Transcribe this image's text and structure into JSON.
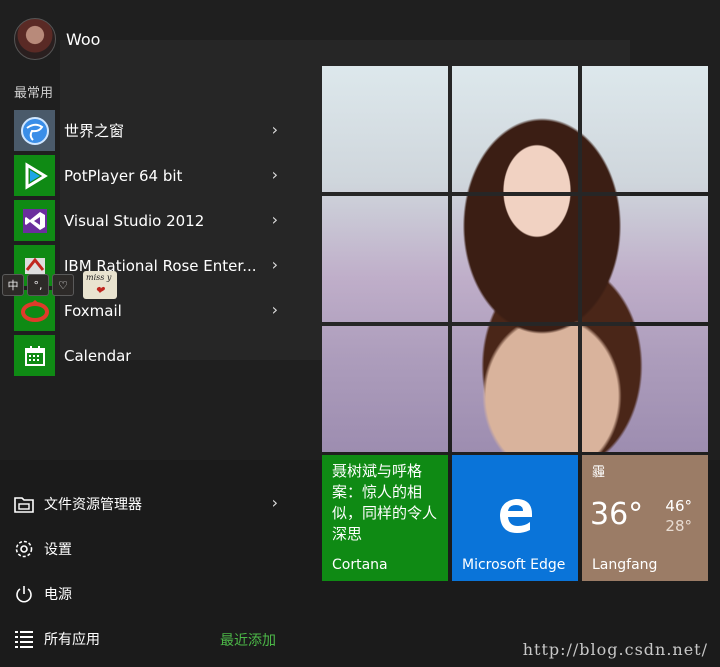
{
  "user": {
    "name": "Woo"
  },
  "left": {
    "section_label": "最常用",
    "apps": [
      {
        "label": "世界之窗",
        "icon": "globe-icon",
        "color": "#4a5a6a",
        "has_arrow": true
      },
      {
        "label": "PotPlayer 64 bit",
        "icon": "play-icon",
        "color": "#0f8a14",
        "has_arrow": true
      },
      {
        "label": "Visual Studio 2012",
        "icon": "visual-studio-icon",
        "color": "#0f8a14",
        "has_arrow": true
      },
      {
        "label": "IBM Rational Rose Enter...",
        "icon": "rose-icon",
        "color": "#0f8a14",
        "has_arrow": true
      },
      {
        "label": "Foxmail",
        "icon": "foxmail-icon",
        "color": "#0f8a14",
        "has_arrow": true
      },
      {
        "label": "Calendar",
        "icon": "calendar-icon",
        "color": "#0f8a14",
        "has_arrow": false
      }
    ],
    "bottom": {
      "explorer": "文件资源管理器",
      "settings": "设置",
      "power": "电源",
      "all_apps": "所有应用",
      "recently_added": "最近添加"
    }
  },
  "ime": {
    "lang": "中",
    "punct": "°,",
    "skin_text": "miss y"
  },
  "tiles": {
    "cortana": {
      "text": "聂树斌与呼格案：惊人的相似，同样的令人深思",
      "label": "Cortana"
    },
    "edge": {
      "label": "Microsoft Edge"
    },
    "weather": {
      "condition": "霾",
      "temp": "36°",
      "high": "46°",
      "low": "28°",
      "label": "Langfang"
    }
  },
  "watermark": "http://blog.csdn.net/",
  "colors": {
    "accent_green": "#0f8a14",
    "edge_blue": "#0a74d9",
    "weather_brown": "#9b7c66",
    "recent_green": "#4cb848"
  }
}
